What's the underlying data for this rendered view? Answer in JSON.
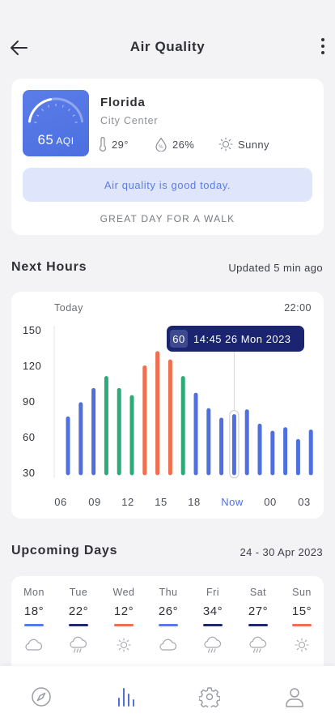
{
  "header": {
    "title": "Air Quality"
  },
  "aqi": {
    "value": "65",
    "unit": "AQI",
    "level_fraction": 0.43,
    "city": "Florida",
    "district": "City Center",
    "temperature": "29°",
    "humidity": "26%",
    "condition": "Sunny",
    "banner": "Air quality is good today.",
    "tip": "GREAT DAY FOR A WALK"
  },
  "next_hours": {
    "title": "Next Hours",
    "updated": "Updated 5 min ago",
    "left_label": "Today",
    "right_label": "22:00",
    "tooltip_value": "60",
    "tooltip_text": "14:45 26 Mon 2023",
    "now_label": "Now"
  },
  "chart_data": {
    "type": "bar",
    "title": "",
    "ylim": [
      30,
      150
    ],
    "y_ticks": [
      "150",
      "120",
      "90",
      "60",
      "30"
    ],
    "x_tick_labels": [
      "06",
      "09",
      "12",
      "15",
      "18",
      "Now",
      "00",
      "03"
    ],
    "values": [
      76,
      88,
      100,
      110,
      100,
      94,
      119,
      131,
      124,
      110,
      96,
      83,
      75,
      78,
      82,
      70,
      64,
      67,
      57,
      65
    ],
    "bar_colors": [
      "#4f6fdf",
      "#4f6fdf",
      "#4f6fdf",
      "#2bac76",
      "#2bac76",
      "#2bac76",
      "#ef6f4f",
      "#ef6f4f",
      "#ef6f4f",
      "#2bac76",
      "#4f6fdf",
      "#4f6fdf",
      "#4f6fdf",
      "#4f6fdf",
      "#4f6fdf",
      "#4f6fdf",
      "#4f6fdf",
      "#4f6fdf",
      "#4f6fdf",
      "#4f6fdf"
    ],
    "selected_index": 13,
    "grid": false
  },
  "upcoming": {
    "title": "Upcoming Days",
    "range": "24 - 30 Apr 2023",
    "days": [
      {
        "name": "Mon",
        "temp": "18°",
        "color": "#5b7be4",
        "icon": "cloud-icon"
      },
      {
        "name": "Tue",
        "temp": "22°",
        "color": "#1e2a6b",
        "icon": "rain-cloud-icon"
      },
      {
        "name": "Wed",
        "temp": "12°",
        "color": "#ef6f4f",
        "icon": "sun-icon"
      },
      {
        "name": "Thu",
        "temp": "26°",
        "color": "#5b7be4",
        "icon": "cloud-icon"
      },
      {
        "name": "Fri",
        "temp": "34°",
        "color": "#1e2a6b",
        "icon": "rain-cloud-icon"
      },
      {
        "name": "Sat",
        "temp": "27°",
        "color": "#1e2a6b",
        "icon": "rain-cloud-icon"
      },
      {
        "name": "Sun",
        "temp": "15°",
        "color": "#ef6f4f",
        "icon": "sun-icon"
      }
    ]
  },
  "nav": {
    "items": [
      "compass-icon",
      "chart-bars-icon",
      "gear-icon",
      "user-icon"
    ],
    "active": 1
  },
  "colors": {
    "accent": "#4f6fdf",
    "green": "#2bac76",
    "orange": "#ef6f4f",
    "navy": "#1e2a6b"
  }
}
